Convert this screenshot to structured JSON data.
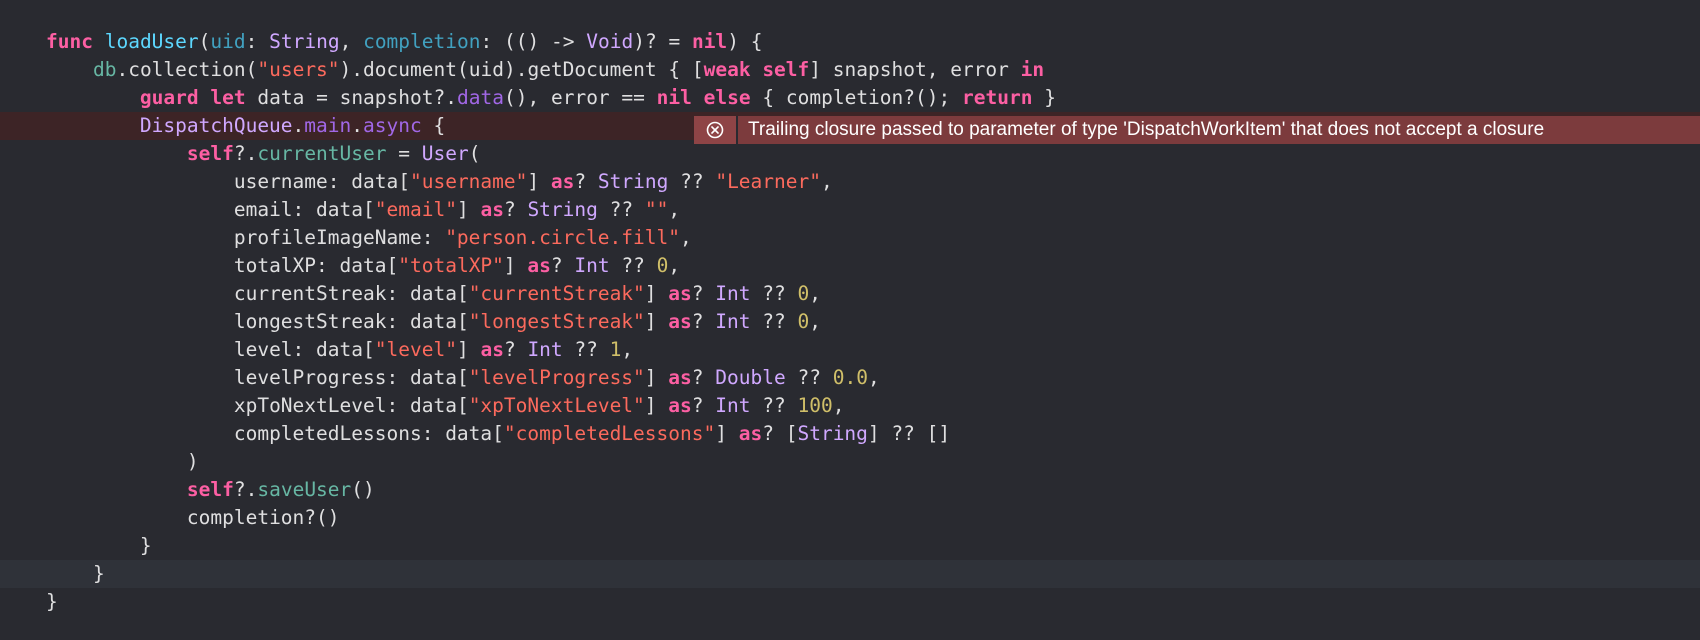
{
  "editor": {
    "lines": [
      "func loadUser(uid: String, completion: (() -> Void)? = nil) {",
      "    db.collection(\"users\").document(uid).getDocument { [weak self] snapshot, error in",
      "        guard let data = snapshot?.data(), error == nil else { completion?(); return }",
      "        DispatchQueue.main.async {",
      "            self?.currentUser = User(",
      "                username: data[\"username\"] as? String ?? \"Learner\",",
      "                email: data[\"email\"] as? String ?? \"\",",
      "                profileImageName: \"person.circle.fill\",",
      "                totalXP: data[\"totalXP\"] as? Int ?? 0,",
      "                currentStreak: data[\"currentStreak\"] as? Int ?? 0,",
      "                longestStreak: data[\"longestStreak\"] as? Int ?? 0,",
      "                level: data[\"level\"] as? Int ?? 1,",
      "                levelProgress: data[\"levelProgress\"] as? Double ?? 0.0,",
      "                xpToNextLevel: data[\"xpToNextLevel\"] as? Int ?? 100,",
      "                completedLessons: data[\"completedLessons\"] as? [String] ?? []",
      "            )",
      "            self?.saveUser()",
      "            completion?()",
      "        }",
      "    }",
      "}"
    ],
    "error_line_index": 3,
    "current_line_index": 19
  },
  "error": {
    "icon": "error-circle-x-icon",
    "message": "Trailing closure passed to parameter of type 'DispatchWorkItem' that does not accept a closure"
  },
  "colors": {
    "background": "#292a30",
    "keyword": "#fc5fa3",
    "type": "#d0a8ff",
    "string": "#fc6a5d",
    "number": "#d0bf69",
    "error_banner": "#7c3b3d",
    "error_line": "#3d2426"
  }
}
